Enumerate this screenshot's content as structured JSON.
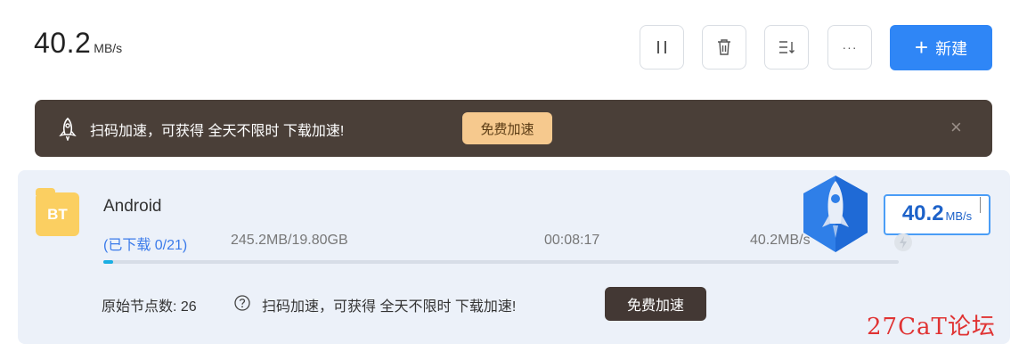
{
  "header": {
    "speed_value": "40.2",
    "speed_unit": "MB/s",
    "new_button_plus": "+",
    "new_button_label": "新建"
  },
  "toolbar": {
    "pause_icon": "pause-icon",
    "delete_icon": "trash-icon",
    "sort_icon": "sort-icon",
    "more_label": "···"
  },
  "promo_bar": {
    "text": "扫码加速，可获得 全天不限时 下载加速!",
    "button": "免费加速",
    "close": "×"
  },
  "task": {
    "type_badge": "BT",
    "name": "Android",
    "status": "(已下载 0/21)",
    "size": "245.2MB/19.80GB",
    "eta": "00:08:17",
    "speed": "40.2MB/s",
    "progress_fraction": 0.012,
    "nodes_label": "原始节点数: 26",
    "promo_text": "扫码加速，可获得 全天不限时 下载加速!",
    "promo_button": "免费加速"
  },
  "speed_badge": {
    "value": "40.2",
    "unit": "MB/s"
  },
  "watermark": "27CaT论坛",
  "colors": {
    "accent": "#2f86f6",
    "promo_bg": "#4a3f38",
    "promo_button": "#f6c98e",
    "card_bg": "#ecf1f9",
    "progress": "#1aaee3",
    "status_blue": "#3b7bea",
    "watermark_red": "#e03333"
  }
}
